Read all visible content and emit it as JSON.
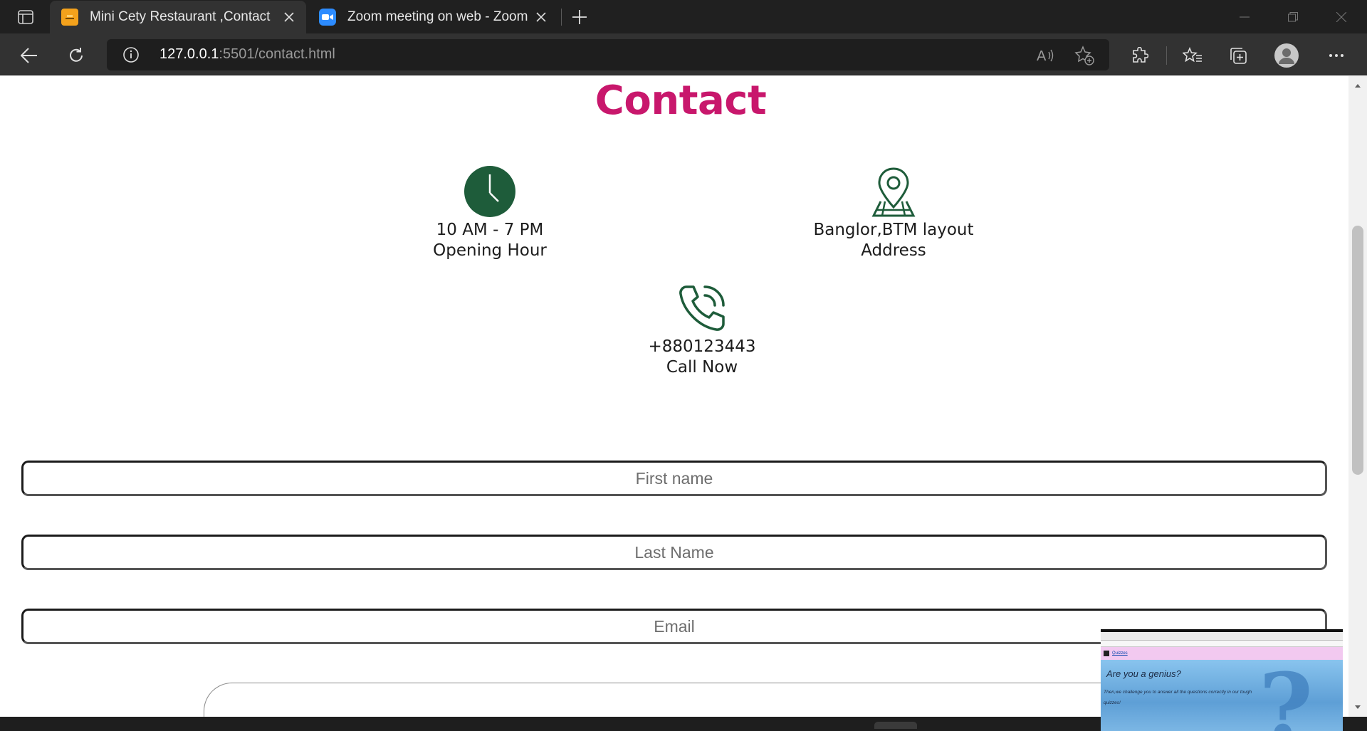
{
  "browser": {
    "tabs": [
      {
        "title": "Mini Cety Restaurant ,Contact",
        "active": true
      },
      {
        "title": "Zoom meeting on web - Zoom",
        "active": false
      }
    ],
    "url_host": "127.0.0.1",
    "url_rest": ":5501/contact.html"
  },
  "page": {
    "heading": "Contact",
    "info": [
      {
        "title": "10 AM - 7 PM",
        "subtitle": "Opening Hour",
        "icon": "clock-icon"
      },
      {
        "title": "Banglor,BTM layout",
        "subtitle": "Address",
        "icon": "map-pin-icon"
      },
      {
        "title": "+880123443",
        "subtitle": "Call Now",
        "icon": "phone-icon"
      }
    ],
    "form": {
      "first_name_placeholder": "First name",
      "last_name_placeholder": "Last Name",
      "email_placeholder": "Email"
    },
    "accent_color": "#c8176c",
    "icon_color": "#1e5c3a"
  },
  "pip": {
    "nav_link": "Quizzes",
    "heading": "Are you a genius?",
    "text": "Then,we challenge you to answer all the questions correctly in our tough quizzes!"
  }
}
